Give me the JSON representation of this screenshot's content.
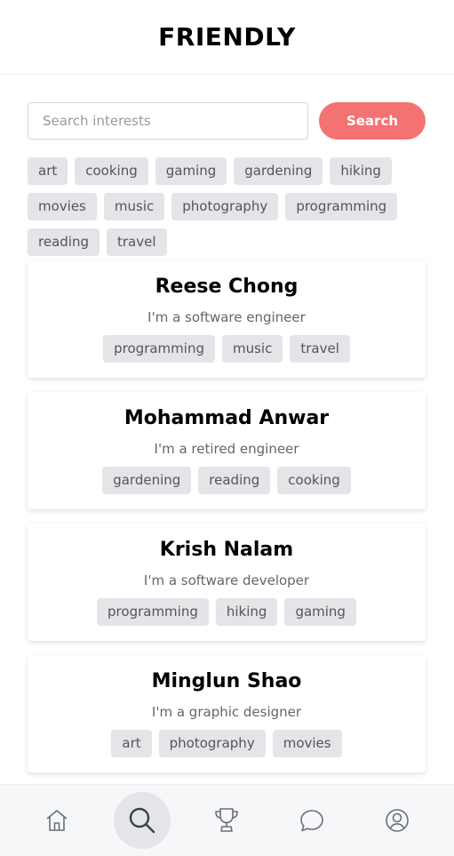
{
  "header": {
    "title": "FRIENDLY"
  },
  "search": {
    "placeholder": "Search interests",
    "value": "",
    "button_label": "Search"
  },
  "interests": [
    "art",
    "cooking",
    "gaming",
    "gardening",
    "hiking",
    "movies",
    "music",
    "photography",
    "programming",
    "reading",
    "travel"
  ],
  "profiles": [
    {
      "name": "Reese Chong",
      "bio": "I'm a software engineer",
      "tags": [
        "programming",
        "music",
        "travel"
      ]
    },
    {
      "name": "Mohammad Anwar",
      "bio": "I'm a retired engineer",
      "tags": [
        "gardening",
        "reading",
        "cooking"
      ]
    },
    {
      "name": "Krish Nalam",
      "bio": "I'm a software developer",
      "tags": [
        "programming",
        "hiking",
        "gaming"
      ]
    },
    {
      "name": "Minglun Shao",
      "bio": "I'm a graphic designer",
      "tags": [
        "art",
        "photography",
        "movies"
      ]
    }
  ],
  "nav": [
    {
      "icon": "home-icon",
      "active": false
    },
    {
      "icon": "search-icon",
      "active": true
    },
    {
      "icon": "trophy-icon",
      "active": false
    },
    {
      "icon": "chat-icon",
      "active": false
    },
    {
      "icon": "profile-icon",
      "active": false
    }
  ],
  "colors": {
    "accent": "#f47272",
    "chip_bg": "#e3e5e8",
    "nav_bg": "#f6f7f9"
  }
}
